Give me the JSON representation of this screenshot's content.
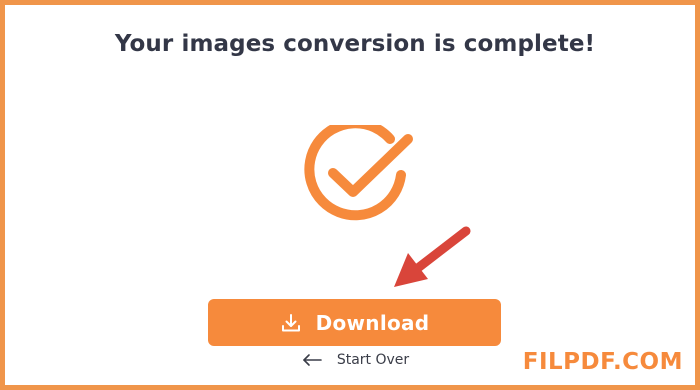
{
  "dialog": {
    "title": "Your images conversion is complete!",
    "status": "complete"
  },
  "icons": {
    "success": "check-circle-icon",
    "pointer": "red-arrow-icon",
    "download": "download-icon",
    "back": "arrow-left-icon"
  },
  "actions": {
    "download_label": "Download",
    "start_over_label": "Start Over"
  },
  "watermark": {
    "text": "FILPDF.COM"
  },
  "colors": {
    "accent": "#f68a3c",
    "frame_border": "#f0954a",
    "arrow": "#d9453a",
    "title_text": "#333747",
    "link_text": "#3a3d48"
  }
}
